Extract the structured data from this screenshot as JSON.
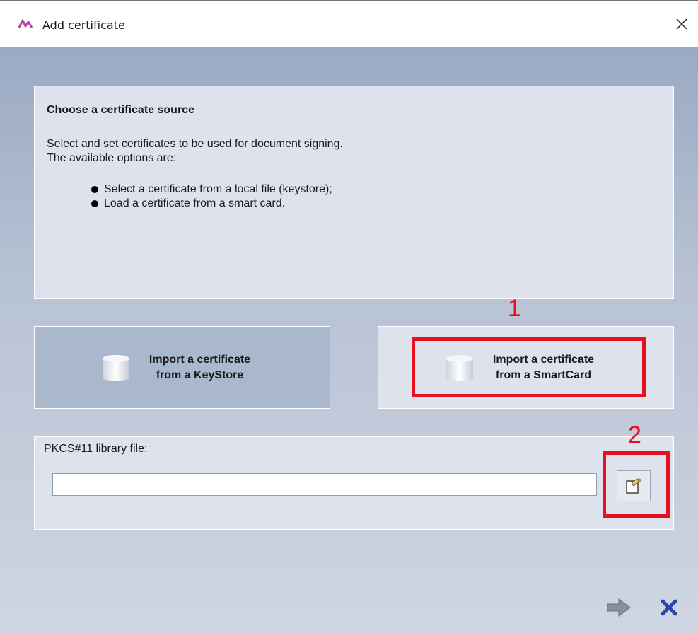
{
  "window": {
    "title": "Add certificate",
    "icon": "app-logo-icon",
    "close_icon": "close-icon"
  },
  "info_panel": {
    "heading": "Choose a certificate source",
    "description_line1": "Select and set certificates to be used for document signing.",
    "description_line2": "The available options are:",
    "bullets": [
      "Select a certificate from a local file (keystore);",
      "Load a certificate from a smart card."
    ]
  },
  "source_buttons": {
    "keystore": {
      "line1": "Import a certificate",
      "line2": "from a KeyStore",
      "icon": "cylinder-icon"
    },
    "smartcard": {
      "line1": "Import a certificate",
      "line2": "from a SmartCard",
      "icon": "cylinder-icon"
    }
  },
  "pkcs": {
    "label": "PKCS#11 library file:",
    "value": "",
    "placeholder": "",
    "browse_icon": "browse-file-icon"
  },
  "annotations": {
    "step1": "1",
    "step2": "2",
    "color": "#e8101f"
  },
  "footer": {
    "next_icon": "next-arrow-icon",
    "cancel_icon": "cancel-x-icon"
  },
  "colors": {
    "client_background_top": "#9aaac3",
    "panel_background": "#dde2ec",
    "keystore_button_background": "#a9b8cd"
  }
}
